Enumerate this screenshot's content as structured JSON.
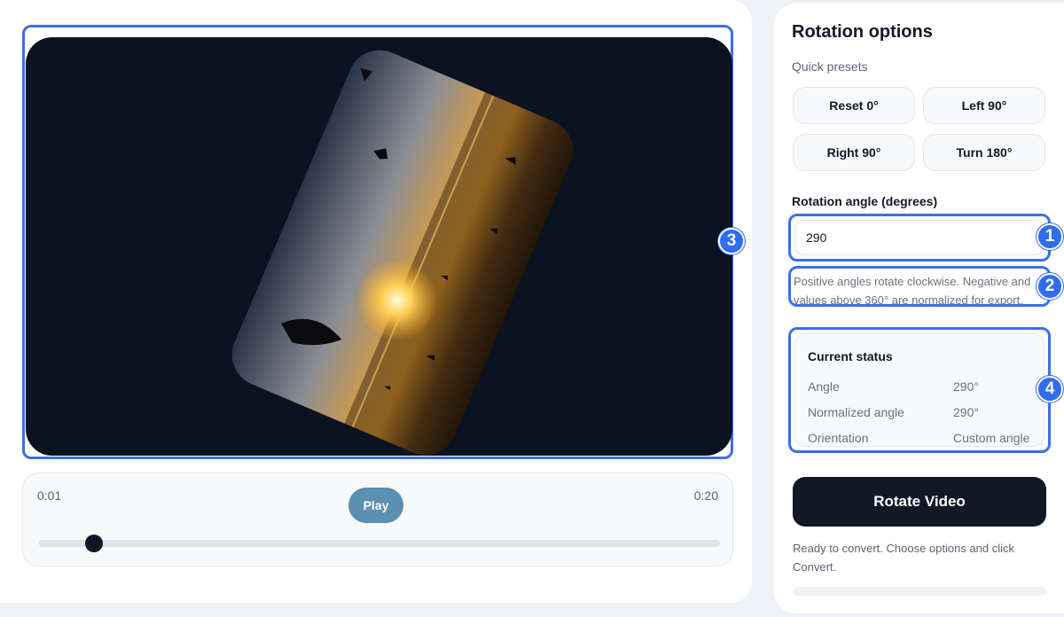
{
  "player": {
    "current_time": "0:01",
    "total_time": "0:20",
    "play_label": "Play",
    "progress_fraction": 0.05
  },
  "panel": {
    "title": "Rotation options",
    "presets_label": "Quick presets",
    "presets": [
      "Reset 0°",
      "Left 90°",
      "Right 90°",
      "Turn 180°"
    ],
    "angle_label": "Rotation angle (degrees)",
    "angle_value": "290",
    "hint": "Positive angles rotate clockwise. Negative and values above 360° are normalized for export.",
    "status": {
      "title": "Current status",
      "rows": [
        {
          "label": "Angle",
          "value": "290°"
        },
        {
          "label": "Normalized angle",
          "value": "290°"
        },
        {
          "label": "Orientation",
          "value": "Custom angle"
        }
      ]
    },
    "rotate_label": "Rotate Video",
    "ready_text": "Ready to convert. Choose options and click Convert."
  },
  "badges": [
    "1",
    "2",
    "3",
    "4"
  ],
  "colors": {
    "accent": "#3b6fe8",
    "badge": "#2f6df0",
    "dark": "#111827",
    "play": "#5b8fb3"
  }
}
